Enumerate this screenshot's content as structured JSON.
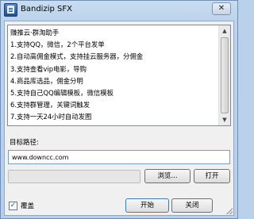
{
  "window": {
    "title": "Bandizip SFX",
    "close_glyph": "✕"
  },
  "content_lines": [
    "赚推云·群淘助手",
    "1.支持QQ，微信，2个平台发单",
    "2.自动高佣金模式，支持挂云服务器，分佣金",
    "3.支持查看vip电影，导购",
    "4.商品库选品，佣金分明",
    "5.支持自己QQ编辑模板，微信模板",
    "6.支持群管理，关键词触发",
    "7.支持一天24小时自动发图"
  ],
  "target_path": {
    "label": "目标路径:",
    "value": "www.downcc.com"
  },
  "progress": {
    "value": 0.0
  },
  "buttons": {
    "browse": "浏览...",
    "open": "打开",
    "start": "开始",
    "close": "关闭"
  },
  "overwrite": {
    "label": "覆盖",
    "checked": true,
    "check_glyph": "✓"
  },
  "scrollbar": {
    "up_glyph": "▲",
    "down_glyph": "▼"
  }
}
